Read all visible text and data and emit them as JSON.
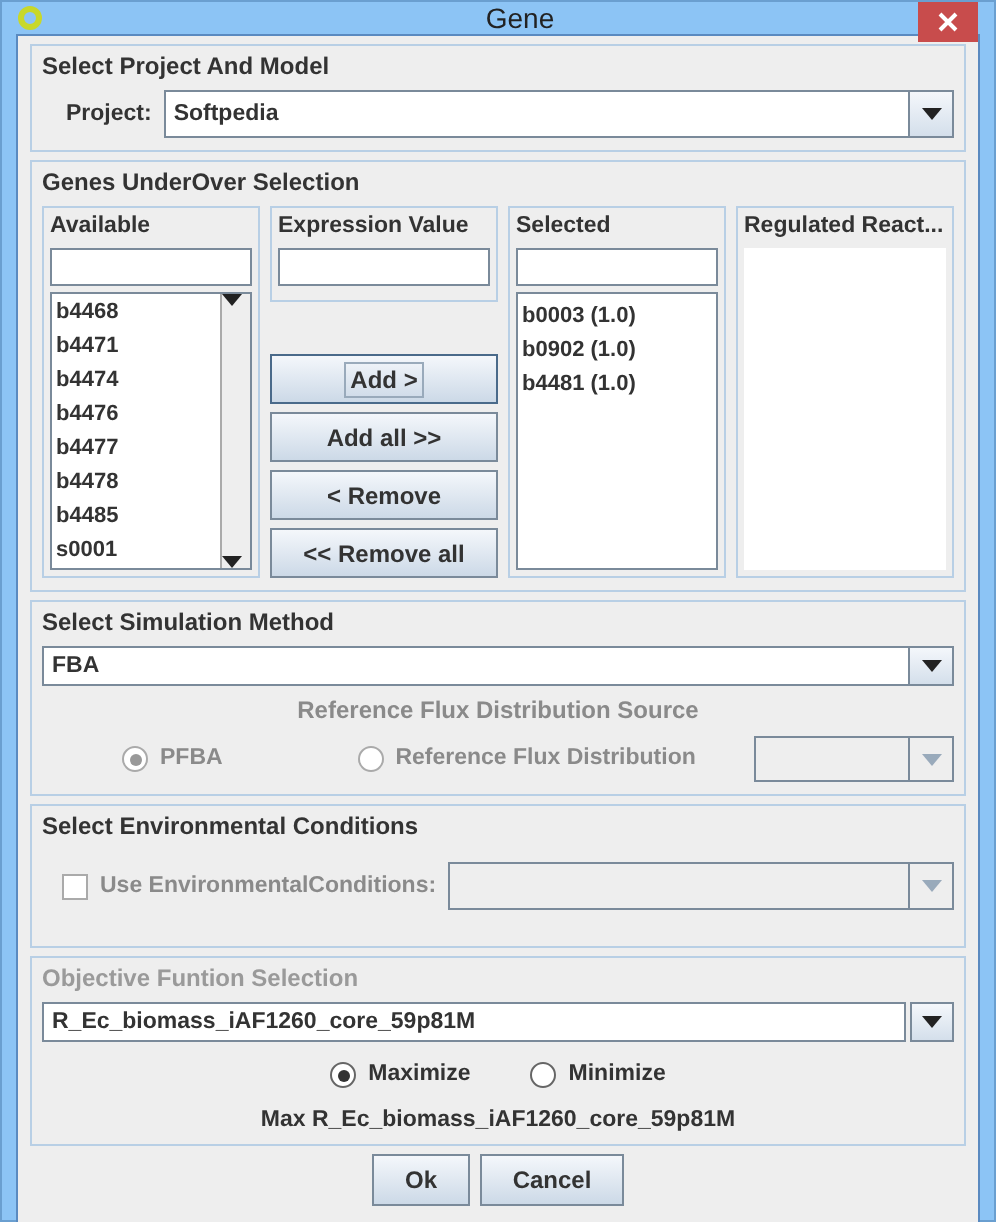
{
  "window": {
    "title": "Gene"
  },
  "project_section": {
    "title": "Select Project And Model",
    "label": "Project:",
    "value": "Softpedia"
  },
  "genes_section": {
    "title": "Genes UnderOver Selection",
    "available": {
      "title": "Available",
      "items": [
        "b4468",
        "b4471",
        "b4474",
        "b4476",
        "b4477",
        "b4478",
        "b4485",
        "s0001"
      ]
    },
    "expression": {
      "title": "Expression Value"
    },
    "buttons": [
      {
        "label": "Add >",
        "focused": true
      },
      {
        "label": "Add all >>",
        "focused": false
      },
      {
        "label": "< Remove",
        "focused": false
      },
      {
        "label": "<< Remove all",
        "focused": false
      }
    ],
    "selected": {
      "title": "Selected",
      "items": [
        "b0003 (1.0)",
        "b0902 (1.0)",
        "b4481 (1.0)"
      ]
    },
    "regulated": {
      "title": "Regulated React..."
    }
  },
  "simulation_section": {
    "title": "Select Simulation Method",
    "method": "FBA",
    "reference_title": "Reference Flux Distribution Source",
    "reference_title_disabled": true,
    "options": [
      {
        "label": "PFBA",
        "selected": true,
        "disabled": true
      },
      {
        "label": "Reference Flux Distribution",
        "selected": false,
        "disabled": true
      }
    ],
    "reference_dropdown_disabled": true
  },
  "environment_section": {
    "title": "Select Environmental Conditions",
    "checkbox": {
      "label": "Use EnvironmentalConditions:",
      "checked": false,
      "disabled": true
    }
  },
  "objective_section": {
    "title": "Objective Funtion Selection",
    "title_disabled": true,
    "function": "R_Ec_biomass_iAF1260_core_59p81M",
    "options": [
      {
        "label": "Maximize",
        "selected": true
      },
      {
        "label": "Minimize",
        "selected": false
      }
    ],
    "summary": "Max R_Ec_biomass_iAF1260_core_59p81M"
  },
  "dialog_buttons": [
    "Ok",
    "Cancel"
  ]
}
